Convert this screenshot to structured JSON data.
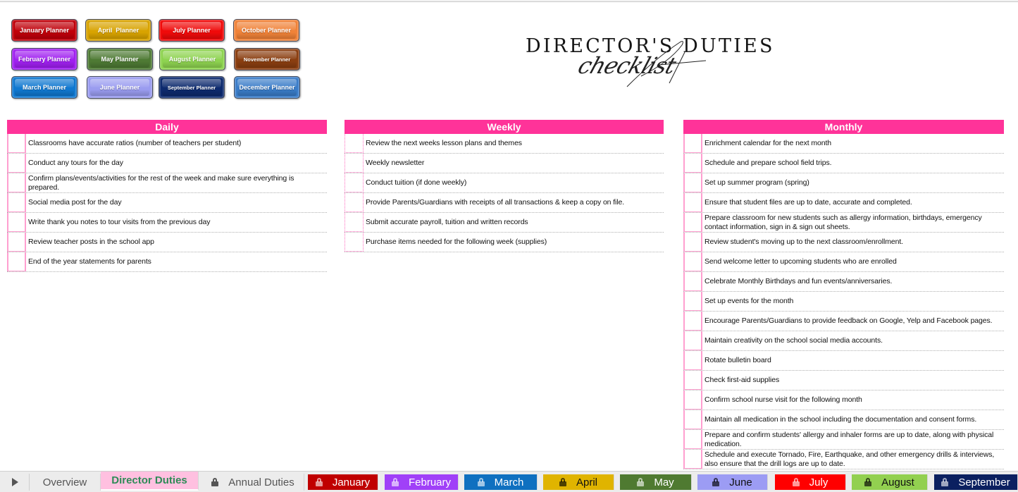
{
  "title": {
    "main": "DIRECTOR'S DUTIES",
    "script": "checklist"
  },
  "planner_buttons": [
    {
      "label": "January Planner",
      "color": "#c0000a"
    },
    {
      "label": "April  Planner",
      "color": "#d8a300"
    },
    {
      "label": "July Planner",
      "color": "#f00a0a"
    },
    {
      "label": "October Planner",
      "color": "#f08238"
    },
    {
      "label": "February Planner",
      "color": "#a020f0"
    },
    {
      "label": "May Planner",
      "color": "#4e7a34"
    },
    {
      "label": "August Planner",
      "color": "#8ed350"
    },
    {
      "label": "November Planner",
      "color": "#8a3e10"
    },
    {
      "label": "March Planner",
      "color": "#1078d0"
    },
    {
      "label": "June Planner",
      "color": "#9a9cf0"
    },
    {
      "label": "September Planner",
      "color": "#0d2a6e"
    },
    {
      "label": "December Planner",
      "color": "#3a7cc8"
    }
  ],
  "sections": {
    "daily": {
      "header": "Daily",
      "items": [
        "Classrooms have accurate ratios (number of teachers per student)",
        "Conduct any tours for the day",
        "Confirm plans/events/activities for the rest of the week and make sure everything is prepared.",
        "Social media post for the day",
        "Write thank you notes to tour visits from the previous day",
        "Review teacher posts in the school app",
        "End of the year statements for parents"
      ]
    },
    "weekly": {
      "header": "Weekly",
      "items": [
        "Review the next weeks lesson plans and themes",
        "Weekly newsletter",
        "Conduct tuition (if done weekly)",
        "Provide Parents/Guardians with receipts of all transactions & keep a copy on file.",
        "Submit accurate payroll, tuition and written records",
        "Purchase items needed for the following week (supplies)"
      ]
    },
    "monthly": {
      "header": "Monthly",
      "items": [
        "Enrichment calendar for the next month",
        "Schedule and prepare school field trips.",
        "Set up summer program (spring)",
        "Ensure that student files are up to date, accurate and completed.",
        "Prepare classroom for new students such as allergy information, birthdays, emergency contact information, sign in & sign out sheets.",
        "Review student's moving up to the next classroom/enrollment.",
        "Send welcome letter to upcoming students who are enrolled",
        "Celebrate Monthly Birthdays and fun events/anniversaries.",
        "Set up events for the month",
        "Encourage Parents/Guardians to provide feedback on Google, Yelp and Facebook pages.",
        "Maintain creativity on the school social media accounts.",
        "Rotate bulletin board",
        "Check first-aid supplies",
        "Confirm school nurse visit for the following month",
        "Maintain all medication in the school including the documentation and consent forms.",
        "Prepare and confirm students' allergy and inhaler forms are up to date, along with physical medication.",
        "Schedule and execute Tornado, Fire, Earthquake, and other emergency drills & interviews, also ensure that the drill logs are up to date."
      ]
    }
  },
  "sheet_tabs": [
    {
      "label": "Overview",
      "locked": false,
      "bg": "#ececec",
      "fg": "#555555",
      "active": false
    },
    {
      "label": "Director Duties",
      "locked": false,
      "bg": "#ffc0e0",
      "fg": "#2e8b57",
      "active": true
    },
    {
      "label": "Annual Duties",
      "locked": true,
      "bg": "#ececec",
      "fg": "#555555",
      "active": false
    },
    {
      "label": "January",
      "locked": true,
      "bg": "#c00000",
      "fg": "#ffffff",
      "active": false
    },
    {
      "label": "February",
      "locked": true,
      "bg": "#a040f8",
      "fg": "#ffffff",
      "active": false
    },
    {
      "label": "March",
      "locked": true,
      "bg": "#0f70c0",
      "fg": "#ffffff",
      "active": false
    },
    {
      "label": "April",
      "locked": true,
      "bg": "#e0b400",
      "fg": "#111111",
      "active": false
    },
    {
      "label": "May",
      "locked": true,
      "bg": "#4f7a31",
      "fg": "#ffffff",
      "active": false
    },
    {
      "label": "June",
      "locked": true,
      "bg": "#9c9cf4",
      "fg": "#111111",
      "active": false
    },
    {
      "label": "July",
      "locked": true,
      "bg": "#ff0000",
      "fg": "#ffffff",
      "active": false
    },
    {
      "label": "August",
      "locked": true,
      "bg": "#92d050",
      "fg": "#111111",
      "active": false
    },
    {
      "label": "September",
      "locked": true,
      "bg": "#0b2060",
      "fg": "#ffffff",
      "active": false
    }
  ],
  "tabbar": {
    "scroll_icon": "play-triangle-icon"
  }
}
